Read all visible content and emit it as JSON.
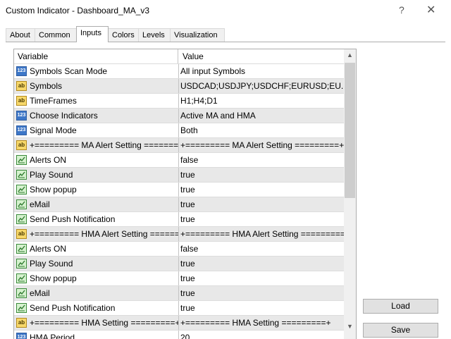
{
  "window": {
    "title": "Custom Indicator - Dashboard_MA_v3",
    "help": "?",
    "close": "✕"
  },
  "tabs": [
    "About",
    "Common",
    "Inputs",
    "Colors",
    "Levels",
    "Visualization"
  ],
  "active_tab": "Inputs",
  "grid": {
    "headers": {
      "variable": "Variable",
      "value": "Value"
    },
    "rows": [
      {
        "icon": "numeric-icon",
        "variable": "Symbols Scan Mode",
        "value": "All input Symbols"
      },
      {
        "icon": "string-icon",
        "variable": "Symbols",
        "value": "USDCAD;USDJPY;USDCHF;EURUSD;EU..."
      },
      {
        "icon": "string-icon",
        "variable": "TimeFrames",
        "value": "H1;H4;D1"
      },
      {
        "icon": "numeric-icon",
        "variable": "Choose Indicators",
        "value": "Active MA and HMA"
      },
      {
        "icon": "numeric-icon",
        "variable": "Signal Mode",
        "value": "Both"
      },
      {
        "icon": "string-icon",
        "variable": "+========= MA Alert Setting =======...",
        "value": "+========= MA Alert Setting =========+"
      },
      {
        "icon": "bool-icon",
        "variable": "Alerts ON",
        "value": "false"
      },
      {
        "icon": "bool-icon",
        "variable": "Play Sound",
        "value": "true"
      },
      {
        "icon": "bool-icon",
        "variable": "Show popup",
        "value": "true"
      },
      {
        "icon": "bool-icon",
        "variable": "eMail",
        "value": "true"
      },
      {
        "icon": "bool-icon",
        "variable": "Send Push Notification",
        "value": "true"
      },
      {
        "icon": "string-icon",
        "variable": "+========= HMA Alert Setting ======...",
        "value": "+========= HMA Alert Setting =========+"
      },
      {
        "icon": "bool-icon",
        "variable": "Alerts ON",
        "value": "false"
      },
      {
        "icon": "bool-icon",
        "variable": "Play Sound",
        "value": "true"
      },
      {
        "icon": "bool-icon",
        "variable": "Show popup",
        "value": "true"
      },
      {
        "icon": "bool-icon",
        "variable": "eMail",
        "value": "true"
      },
      {
        "icon": "bool-icon",
        "variable": "Send Push Notification",
        "value": "true"
      },
      {
        "icon": "string-icon",
        "variable": "+========= HMA Setting =========+",
        "value": "+========= HMA Setting =========+"
      },
      {
        "icon": "numeric-icon",
        "variable": "HMA Period",
        "value": "20"
      }
    ],
    "scrollbar": {
      "up": "▲",
      "down": "▼"
    }
  },
  "buttons": {
    "load": "Load",
    "save": "Save"
  }
}
